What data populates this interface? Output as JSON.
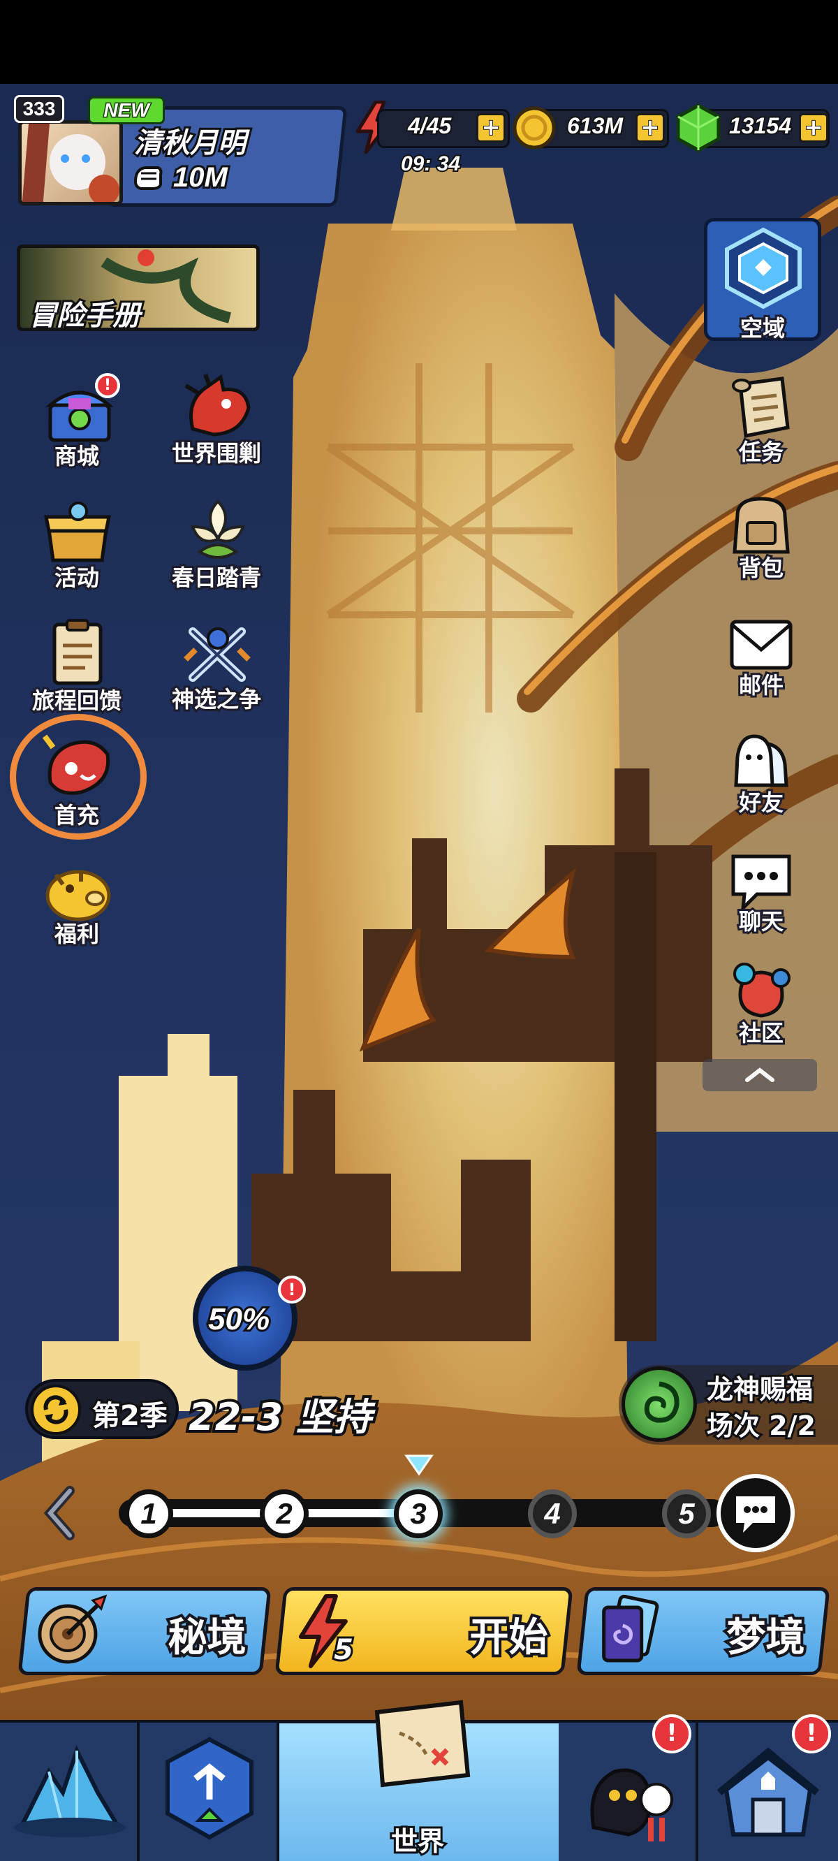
{
  "player": {
    "level": "333",
    "new_tag": "NEW",
    "name": "清秋月明",
    "power": "10M"
  },
  "resources": {
    "energy": "4/45",
    "energy_timer": "09: 34",
    "gold": "613M",
    "gems": "13154"
  },
  "adventure_book": {
    "label": "冒险手册"
  },
  "left_menu": [
    {
      "id": "shop",
      "label": "商城",
      "icon": "treasure-chest-icon",
      "alert": "!"
    },
    {
      "id": "world-siege",
      "label": "世界围剿",
      "icon": "red-dragon-icon"
    },
    {
      "id": "events",
      "label": "活动",
      "icon": "treasure-box-icon"
    },
    {
      "id": "spring",
      "label": "春日踏青",
      "icon": "flower-icon"
    },
    {
      "id": "journey",
      "label": "旅程回馈",
      "icon": "clipboard-icon"
    },
    {
      "id": "chosen",
      "label": "神选之争",
      "icon": "crossed-swords-icon"
    },
    {
      "id": "first-charge",
      "label": "首充",
      "icon": "red-creature-icon"
    },
    {
      "id": "welfare",
      "label": "福利",
      "icon": "golden-pig-icon"
    }
  ],
  "right_menu": [
    {
      "id": "sky",
      "label": "空域",
      "icon": "portal-icon"
    },
    {
      "id": "quests",
      "label": "任务",
      "icon": "scroll-icon"
    },
    {
      "id": "bag",
      "label": "背包",
      "icon": "backpack-icon"
    },
    {
      "id": "mail",
      "label": "邮件",
      "icon": "envelope-icon"
    },
    {
      "id": "friends",
      "label": "好友",
      "icon": "friends-icon"
    },
    {
      "id": "chat",
      "label": "聊天",
      "icon": "chat-bubble-icon"
    },
    {
      "id": "community",
      "label": "社区",
      "icon": "community-icon"
    }
  ],
  "promo": {
    "percent": "50%",
    "alert": "!"
  },
  "season": {
    "label": "第2季",
    "stage": "22-3 坚持"
  },
  "dragon_blessing": {
    "line1": "龙神赐福",
    "line2": "场次 2/2"
  },
  "stage_nodes": [
    "1",
    "2",
    "3",
    "4",
    "5"
  ],
  "stage_progress": {
    "current": 3,
    "total": 5
  },
  "actions": {
    "secret": "秘境",
    "start": "开始",
    "start_cost": "5",
    "dream": "梦境"
  },
  "bottom_nav": {
    "world": "世界",
    "alert": "!"
  },
  "colors": {
    "accent_orange": "#f08a3c",
    "bg_blue": "#1d2e55",
    "gold": "#f4c431",
    "gem_green": "#5bd23c",
    "alert_red": "#e8343b"
  }
}
